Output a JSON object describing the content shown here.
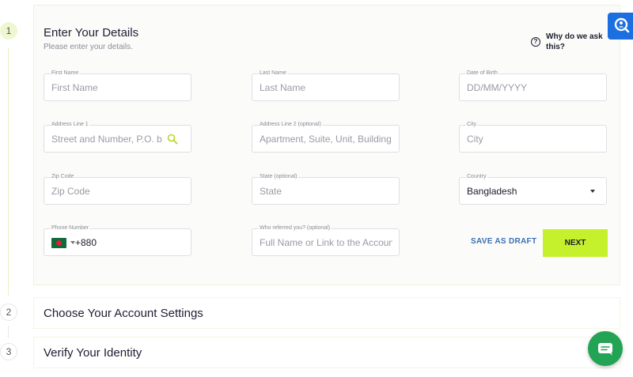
{
  "steps": [
    {
      "number": "1",
      "title": "Enter Your Details",
      "subtitle": "Please enter your details."
    },
    {
      "number": "2",
      "title": "Choose Your Account Settings"
    },
    {
      "number": "3",
      "title": "Verify Your Identity"
    }
  ],
  "help": {
    "why_label": "Why do we ask this?"
  },
  "fields": {
    "first_name": {
      "label": "First Name",
      "placeholder": "First Name"
    },
    "last_name": {
      "label": "Last Name",
      "placeholder": "Last Name"
    },
    "dob": {
      "label": "Date of Birth",
      "placeholder": "DD/MM/YYYY"
    },
    "address1": {
      "label": "Address Line 1",
      "placeholder": "Street and Number, P.O. b"
    },
    "address2": {
      "label": "Address Line 2 (optional)",
      "placeholder": "Apartment, Suite, Unit, Building e"
    },
    "city": {
      "label": "City",
      "placeholder": "City"
    },
    "zip": {
      "label": "Zip Code",
      "placeholder": "Zip Code"
    },
    "state": {
      "label": "State (optional)",
      "placeholder": "State"
    },
    "country": {
      "label": "Country",
      "value": "Bangladesh"
    },
    "phone": {
      "label": "Phone Number",
      "code": "+880"
    },
    "referral": {
      "label": "Who referred you? (optional)",
      "placeholder": "Full Name or Link to the Account"
    }
  },
  "actions": {
    "save_draft": "SAVE AS DRAFT",
    "next": "NEXT"
  },
  "icons": {
    "help_widget": "search-person-icon",
    "chat_widget": "chat-icon",
    "address_search": "search-icon",
    "flag": "bangladesh-flag-icon"
  },
  "colors": {
    "accent": "#c5f02c",
    "link": "#3b6fb6",
    "help_widget": "#1b6fe0",
    "chat_widget": "#23a455"
  }
}
